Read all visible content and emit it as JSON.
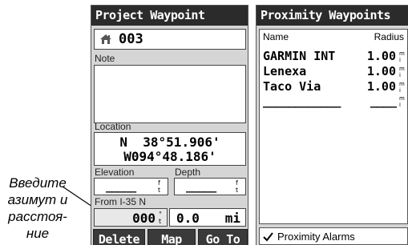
{
  "callout": {
    "lines": [
      "Введите",
      "азимут и",
      "расстоя-",
      "ние"
    ]
  },
  "project_waypoint": {
    "title": "Project Waypoint",
    "waypoint_icon": "house-icon",
    "name": "003",
    "note_label": "Note",
    "note_value": "",
    "location_label": "Location",
    "location_lat": "N  38°51.906'",
    "location_lon": "W094°48.186'",
    "elevation_label": "Elevation",
    "depth_label": "Depth",
    "elevation_value": "_____",
    "elevation_unit": "f t",
    "depth_value": "_____",
    "depth_unit": "f t",
    "from_label": "From I-35 N",
    "bearing_value": "000",
    "bearing_unit": "° t",
    "distance_value": "0.0",
    "distance_unit": "mi",
    "buttons": {
      "delete": "Delete",
      "map": "Map",
      "goto": "Go To"
    }
  },
  "proximity": {
    "title": "Proximity Waypoints",
    "col_name": "Name",
    "col_radius": "Radius",
    "rows": [
      {
        "name": "GARMIN INT",
        "radius": "1.00",
        "unit": "m i"
      },
      {
        "name": "Lenexa",
        "radius": "1.00",
        "unit": "m i"
      },
      {
        "name": "Taco Via",
        "radius": "1.00",
        "unit": "m i"
      }
    ],
    "blank_row": {
      "name": "____________",
      "radius": "____",
      "unit": "m i"
    },
    "alarm_label": "Proximity Alarms",
    "alarm_checked": true
  }
}
